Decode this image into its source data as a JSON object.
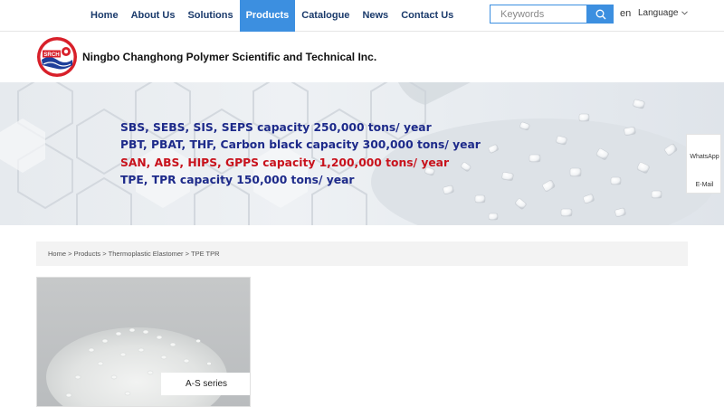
{
  "nav": {
    "items": [
      {
        "label": "Home"
      },
      {
        "label": "About Us"
      },
      {
        "label": "Solutions"
      },
      {
        "label": "Products"
      },
      {
        "label": "Catalogue"
      },
      {
        "label": "News"
      },
      {
        "label": "Contact Us"
      }
    ],
    "active": "Products"
  },
  "search": {
    "placeholder": "Keywords",
    "icon": "search-icon"
  },
  "language": {
    "current": "en",
    "selector_label": "Language"
  },
  "header": {
    "company_name": "Ningbo Changhong Polymer Scientific and Technical Inc.",
    "logo_text": "SRCH"
  },
  "banner": {
    "lines": [
      {
        "text": "SBS, SEBS, SIS, SEPS capacity 250,000 tons/ year",
        "color": "#1d2a8a"
      },
      {
        "text": "PBT, PBAT, THF, Carbon black capacity 300,000 tons/ year",
        "color": "#1d2a8a"
      },
      {
        "text": "SAN, ABS, HIPS, GPPS capacity 1,200,000 tons/ year",
        "color": "#c8121c"
      },
      {
        "text": "TPE, TPR capacity 150,000 tons/ year",
        "color": "#1d2a8a"
      }
    ]
  },
  "side_float": {
    "whatsapp": "WhatsApp",
    "email": "E-Mail"
  },
  "breadcrumb": {
    "items": [
      "Home",
      "Products",
      "Thermoplastic Elastomer",
      "TPE TPR"
    ],
    "separator": ">"
  },
  "products": [
    {
      "caption": "A-S series"
    }
  ],
  "colors": {
    "accent": "#3c8fe0",
    "nav_text": "#1a3a6b",
    "banner_blue": "#1d2a8a",
    "banner_red": "#c8121c"
  }
}
